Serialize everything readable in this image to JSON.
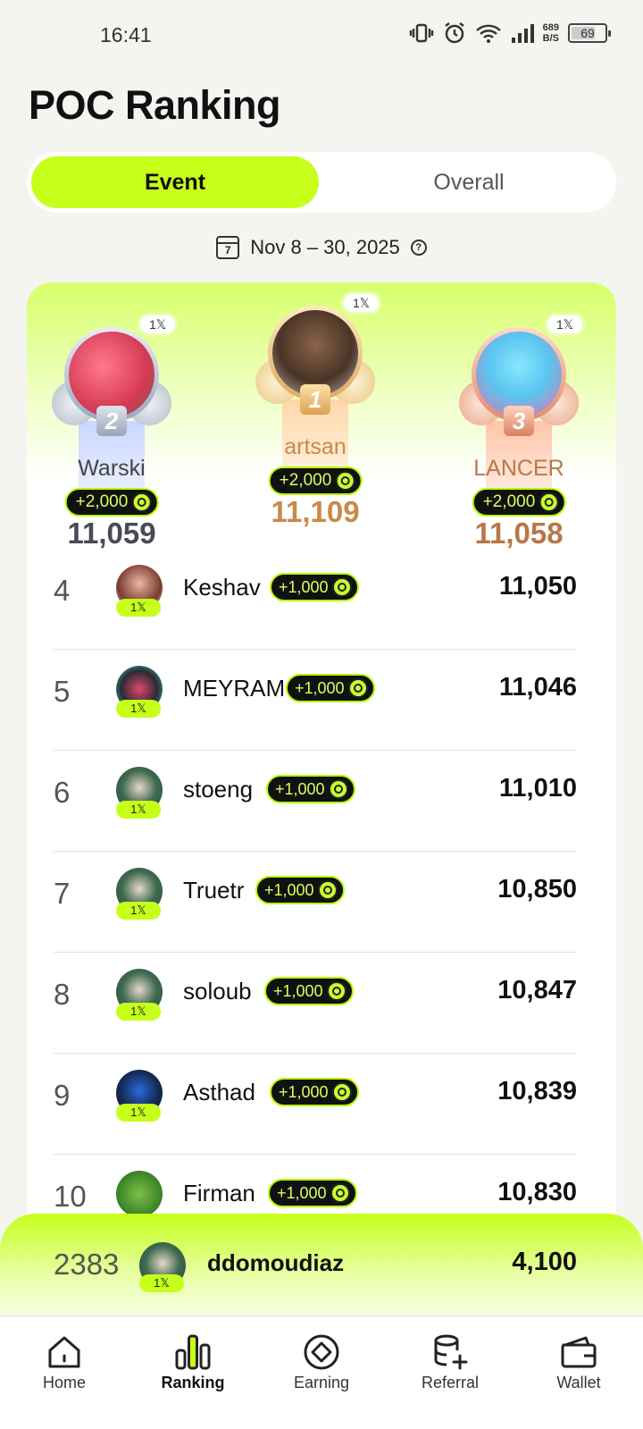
{
  "status": {
    "time": "16:41",
    "net_speed_value": "689",
    "net_speed_unit": "B/S",
    "battery": "69"
  },
  "title": "POC Ranking",
  "tabs": {
    "event": "Event",
    "overall": "Overall",
    "active": "Event"
  },
  "date_range": "Nov 8 – 30, 2025",
  "x_badge_label": "1𝕏",
  "bonus_top": "+2,000",
  "bonus_row": "+1,000",
  "podium": [
    {
      "rank": "2",
      "name": "Warski",
      "bonus": "+2,000",
      "score": "11,059",
      "color": "#4a4a55"
    },
    {
      "rank": "1",
      "name": "artsan",
      "bonus": "+2,000",
      "score": "11,109",
      "color": "#c8894a"
    },
    {
      "rank": "3",
      "name": "LANCER",
      "bonus": "+2,000",
      "score": "11,058",
      "color": "#b8774a"
    }
  ],
  "rows": [
    {
      "rank": "4",
      "name": "Keshav",
      "bonus": "+1,000",
      "score": "11,050"
    },
    {
      "rank": "5",
      "name": "MEYRAM",
      "bonus": "+1,000",
      "score": "11,046"
    },
    {
      "rank": "6",
      "name": "stoeng",
      "bonus": "+1,000",
      "score": "11,010"
    },
    {
      "rank": "7",
      "name": "Truetr",
      "bonus": "+1,000",
      "score": "10,850"
    },
    {
      "rank": "8",
      "name": "soloub",
      "bonus": "+1,000",
      "score": "10,847"
    },
    {
      "rank": "9",
      "name": "Asthad",
      "bonus": "+1,000",
      "score": "10,839"
    },
    {
      "rank": "10",
      "name": "Firman",
      "bonus": "+1,000",
      "score": "10,830"
    }
  ],
  "me": {
    "rank": "2383",
    "name": "ddomoudiaz",
    "score": "4,100"
  },
  "nav": [
    {
      "label": "Home",
      "icon": "home-icon"
    },
    {
      "label": "Ranking",
      "icon": "ranking-icon"
    },
    {
      "label": "Earning",
      "icon": "earning-icon"
    },
    {
      "label": "Referral",
      "icon": "referral-icon"
    },
    {
      "label": "Wallet",
      "icon": "wallet-icon"
    }
  ],
  "colors": {
    "accent": "#c5ff1a",
    "background": "#f4f4f0",
    "pill_bg": "#111111"
  }
}
